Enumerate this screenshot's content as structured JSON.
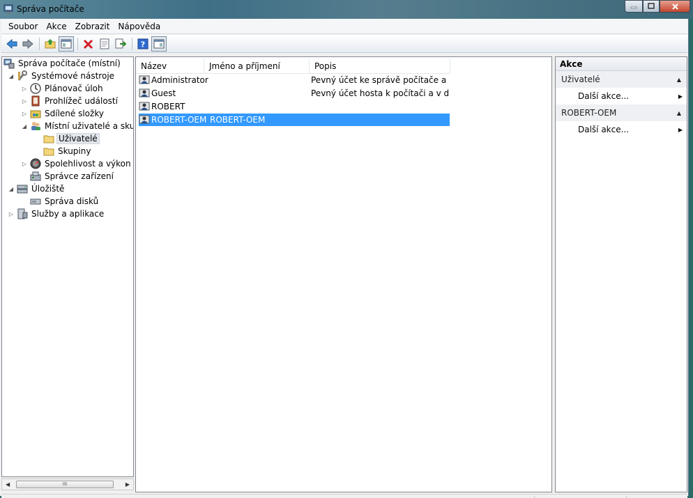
{
  "window": {
    "title": "Správa počítače"
  },
  "menu": [
    {
      "label": "Soubor"
    },
    {
      "label": "Akce"
    },
    {
      "label": "Zobrazit"
    },
    {
      "label": "Nápověda"
    }
  ],
  "toolbar": [
    {
      "icon": "back-arrow-icon"
    },
    {
      "icon": "forward-arrow-icon"
    },
    {
      "icon": "up-folder-icon"
    },
    {
      "icon": "show-hide-tree-icon"
    },
    {
      "icon": "delete-icon"
    },
    {
      "icon": "properties-icon"
    },
    {
      "icon": "export-list-icon"
    },
    {
      "icon": "help-icon"
    },
    {
      "icon": "show-hide-action-pane-icon"
    }
  ],
  "tree": [
    {
      "label": "Správa počítače (místní)",
      "icon": "computer-management-icon",
      "expander": "none"
    },
    {
      "label": "Systémové nástroje",
      "icon": "system-tools-icon",
      "expander": "expanded"
    },
    {
      "label": "Plánovač úloh",
      "icon": "clock-icon",
      "expander": "collapsed"
    },
    {
      "label": "Prohlížeč událostí",
      "icon": "event-viewer-icon",
      "expander": "collapsed"
    },
    {
      "label": "Sdílené složky",
      "icon": "shared-folder-icon",
      "expander": "collapsed"
    },
    {
      "label": "Místní uživatelé a skupiny",
      "icon": "users-groups-icon",
      "expander": "expanded"
    },
    {
      "label": "Uživatelé",
      "icon": "folder-icon",
      "expander": "none",
      "selected": true
    },
    {
      "label": "Skupiny",
      "icon": "folder-icon",
      "expander": "none"
    },
    {
      "label": "Spolehlivost a výkon",
      "icon": "performance-icon",
      "expander": "collapsed"
    },
    {
      "label": "Správce zařízení",
      "icon": "device-manager-icon",
      "expander": "none"
    },
    {
      "label": "Úložiště",
      "icon": "storage-icon",
      "expander": "expanded"
    },
    {
      "label": "Správa disků",
      "icon": "disk-management-icon",
      "expander": "none"
    },
    {
      "label": "Služby a aplikace",
      "icon": "services-icon",
      "expander": "collapsed"
    }
  ],
  "list": {
    "columns": [
      "Název",
      "Jméno a příjmení",
      "Popis"
    ],
    "rows": [
      {
        "name": "Administrator",
        "full_name": "",
        "description": "Pevný účet ke správě počítače a d...",
        "icon": "user-icon"
      },
      {
        "name": "Guest",
        "full_name": "",
        "description": "Pevný účet hosta k počítači a v do...",
        "icon": "user-icon"
      },
      {
        "name": "ROBERT",
        "full_name": "",
        "description": "",
        "icon": "user-icon"
      },
      {
        "name": "ROBERT-OEM",
        "full_name": "ROBERT-OEM",
        "description": "",
        "icon": "user-icon",
        "selected": true
      }
    ]
  },
  "actions": {
    "header": "Akce",
    "sections": [
      {
        "title": "Uživatelé",
        "item": "Další akce..."
      },
      {
        "title": "ROBERT-OEM",
        "item": "Další akce..."
      }
    ]
  },
  "colors": {
    "selection": "#3399ff",
    "delete_icon": "#d4202a"
  }
}
